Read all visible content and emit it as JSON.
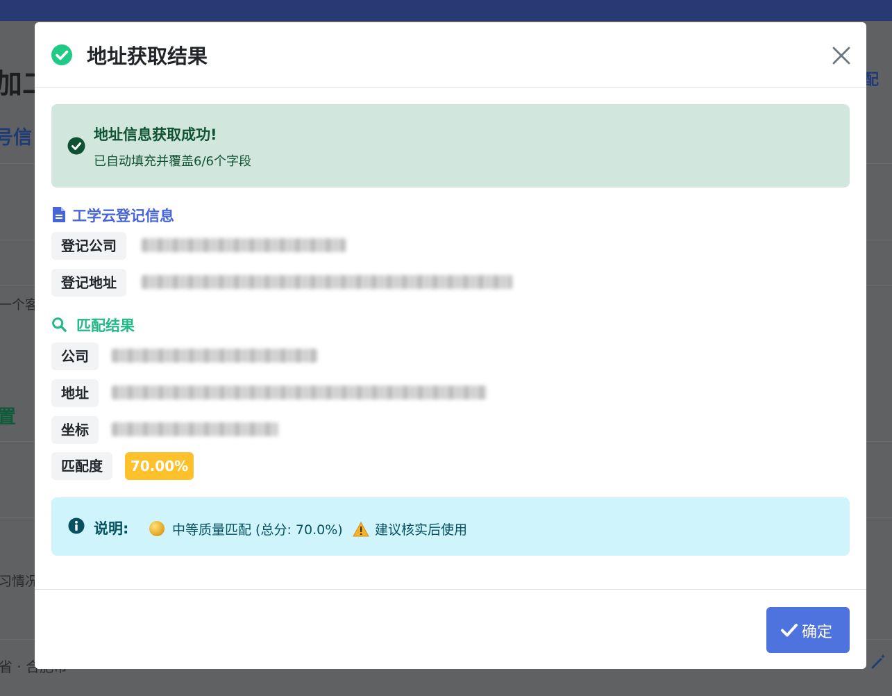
{
  "background": {
    "title_fragment": "加二",
    "section_fragment_1": "号信",
    "section_fragment_2": "置",
    "text_fragment_1": "一个客",
    "text_fragment_2": "习情况",
    "text_fragment_3": "省 · 合肥市",
    "right_fragment": "配"
  },
  "modal": {
    "title": "地址获取结果",
    "close_icon": "close-icon",
    "success_alert": {
      "title": "地址信息获取成功!",
      "subtitle": "已自动填充并覆盖6/6个字段"
    },
    "registration_section": {
      "title": "工学云登记信息",
      "fields": [
        {
          "label": "登记公司"
        },
        {
          "label": "登记地址"
        }
      ]
    },
    "match_section": {
      "title": "匹配结果",
      "fields": [
        {
          "label": "公司"
        },
        {
          "label": "地址"
        },
        {
          "label": "坐标"
        },
        {
          "label": "匹配度"
        }
      ],
      "match_score": "70.00%"
    },
    "info_alert": {
      "label": "说明:",
      "quality_text": "中等质量匹配 (总分: 70.0%)",
      "advice_text": "建议核实后使用"
    },
    "footer": {
      "confirm_label": "确定"
    }
  },
  "colors": {
    "primary": "#4e73df",
    "success_bg": "#d1e7dd",
    "info_bg": "#cff4fc",
    "warning": "#fcc12b",
    "section_blue": "#4665d8",
    "section_green": "#20b887"
  }
}
